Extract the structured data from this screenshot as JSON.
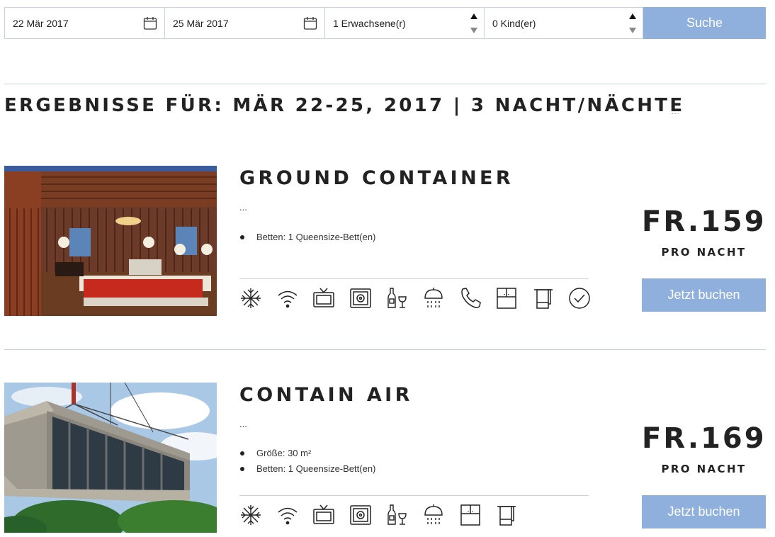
{
  "search": {
    "checkin": "22 Mär 2017",
    "checkout": "25 Mär 2017",
    "adults": "1 Erwachsene(r)",
    "children": "0 Kind(er)",
    "button": "Suche"
  },
  "results_title": "ERGEBNISSE FÜR: MÄR 22-25, 2017 | 3 NACHT/NÄCHTE",
  "rooms": [
    {
      "name": "GROUND CONTAINER",
      "desc": "...",
      "features": [
        "Betten: 1 Queensize-Bett(en)"
      ],
      "price": "FR.159",
      "per_night": "PRO NACHT",
      "book": "Jetzt buchen",
      "amenities": [
        "snowflake-icon",
        "wifi-icon",
        "tv-icon",
        "safe-icon",
        "minibar-icon",
        "shower-icon",
        "phone-icon",
        "closet-icon",
        "towel-icon",
        "check-icon"
      ]
    },
    {
      "name": "CONTAIN AIR",
      "desc": "...",
      "features": [
        "Größe: 30 m²",
        "Betten: 1 Queensize-Bett(en)"
      ],
      "price": "FR.169",
      "per_night": "PRO NACHT",
      "book": "Jetzt buchen",
      "amenities": [
        "snowflake-icon",
        "wifi-icon",
        "tv-icon",
        "safe-icon",
        "minibar-icon",
        "shower-icon",
        "closet-icon",
        "towel-icon"
      ]
    }
  ],
  "colors": {
    "accent": "#8fb0dc",
    "divider": "#c6d3de",
    "text": "#222222"
  }
}
